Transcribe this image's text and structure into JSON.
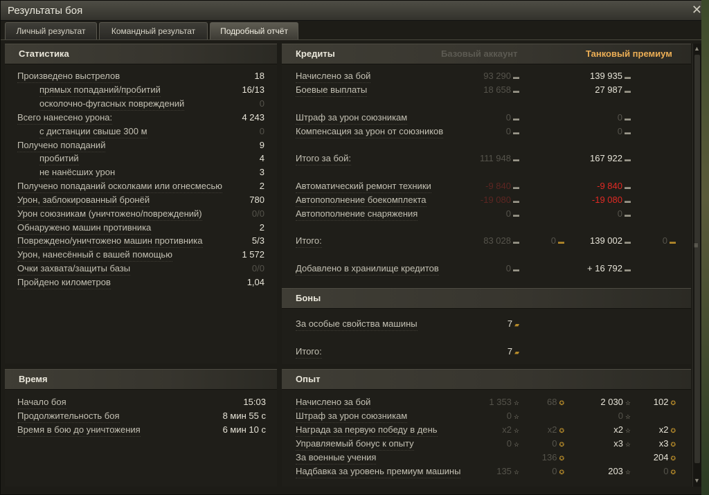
{
  "window": {
    "title": "Результаты боя",
    "close_glyph": "✕"
  },
  "tabs": [
    "Личный результат",
    "Командный результат",
    "Подробный отчёт"
  ],
  "stats": {
    "header": "Статистика",
    "rows": [
      {
        "label": "Произведено выстрелов",
        "value": "18"
      },
      {
        "label": "прямых попаданий/пробитий",
        "value": "16/13"
      },
      {
        "label": "осколочно-фугасных повреждений",
        "value": "0"
      },
      {
        "label": "Всего нанесено урона:",
        "value": "4 243"
      },
      {
        "label": "с дистанции свыше 300 м",
        "value": "0"
      },
      {
        "label": "Получено попаданий",
        "value": "9"
      },
      {
        "label": "пробитий",
        "value": "4"
      },
      {
        "label": "не нанёсших урон",
        "value": "3"
      },
      {
        "label": "Получено попаданий осколками или огнесмесью",
        "value": "2"
      },
      {
        "label": "Урон, заблокированный бронёй",
        "value": "780"
      },
      {
        "label": "Урон союзникам (уничтожено/повреждений)",
        "value": "0/0"
      },
      {
        "label": "Обнаружено машин противника",
        "value": "2"
      },
      {
        "label": "Повреждено/уничтожено машин противника",
        "value": "5/3"
      },
      {
        "label": "Урон, нанесённый с вашей помощью",
        "value": "1 572"
      },
      {
        "label": "Очки захвата/защиты базы",
        "value": "0/0"
      },
      {
        "label": "Пройдено километров",
        "value": "1,04"
      }
    ]
  },
  "time": {
    "header": "Время",
    "rows": [
      {
        "label": "Начало боя",
        "value": "15:03"
      },
      {
        "label": "Продолжительность боя",
        "value": "8 мин 55 с"
      },
      {
        "label": "Время в бою до уничтожения",
        "value": "6 мин 10 с"
      }
    ]
  },
  "credits": {
    "header": "Кредиты",
    "base_header": "Базовый аккаунт",
    "premium_header": "Танковый премиум",
    "rows": [
      {
        "label": "Начислено за бой",
        "base": "93 290",
        "prem": "139 935"
      },
      {
        "label": "Боевые выплаты",
        "base": "18 658",
        "prem": "27 987"
      },
      {
        "label": "Штраф за урон союзникам",
        "base": "0",
        "prem": "0"
      },
      {
        "label": "Компенсация за урон от союзников",
        "base": "0",
        "prem": "0"
      },
      {
        "label": "Итого за бой:",
        "base": "111 948",
        "prem": "167 922"
      },
      {
        "label": "Автоматический ремонт техники",
        "base": "-9 840",
        "prem": "-9 840"
      },
      {
        "label": "Автопополнение боекомплекта",
        "base": "-19 080",
        "prem": "-19 080"
      },
      {
        "label": "Автопополнение снаряжения",
        "base": "0",
        "prem": "0"
      },
      {
        "label": "Итого:",
        "base": "83 028",
        "base_gold": "0",
        "prem": "139 002",
        "prem_gold": "0"
      },
      {
        "label": "Добавлено в хранилище кредитов",
        "base": "0",
        "prem": "+ 16 792"
      }
    ]
  },
  "bonds": {
    "header": "Боны",
    "rows": [
      {
        "label": "За особые свойства машины",
        "value": "7"
      },
      {
        "label": "Итого:",
        "value": "7"
      }
    ]
  },
  "xp": {
    "header": "Опыт",
    "rows": [
      {
        "label": "Начислено за бой",
        "base": "1 353",
        "base_free": "68",
        "prem": "2 030",
        "prem_free": "102"
      },
      {
        "label": "Штраф за урон союзникам",
        "base": "0",
        "prem": "0"
      },
      {
        "label": "Награда за первую победу в день",
        "base": "x2",
        "base_free": "x2",
        "prem": "x2",
        "prem_free": "x2"
      },
      {
        "label": "Управляемый бонус к опыту",
        "base": "0",
        "base_free": "0",
        "prem": "x3",
        "prem_free": "x3"
      },
      {
        "label": "За военные учения",
        "base_free": "136",
        "prem_free": "204"
      },
      {
        "label": "Надбавка за уровень премиум машины",
        "base": "135",
        "base_free": "0",
        "prem": "203",
        "prem_free": "0"
      }
    ]
  },
  "icons": {
    "credit": "credit-icon",
    "gold": "gold-icon",
    "bond": "bond-icon",
    "xp": "xp-star-icon",
    "free_xp": "free-xp-icon"
  },
  "colors": {
    "accent": "#ecae55",
    "negative": "#e02a24",
    "text": "#e7e4d8",
    "muted": "#55534b"
  }
}
